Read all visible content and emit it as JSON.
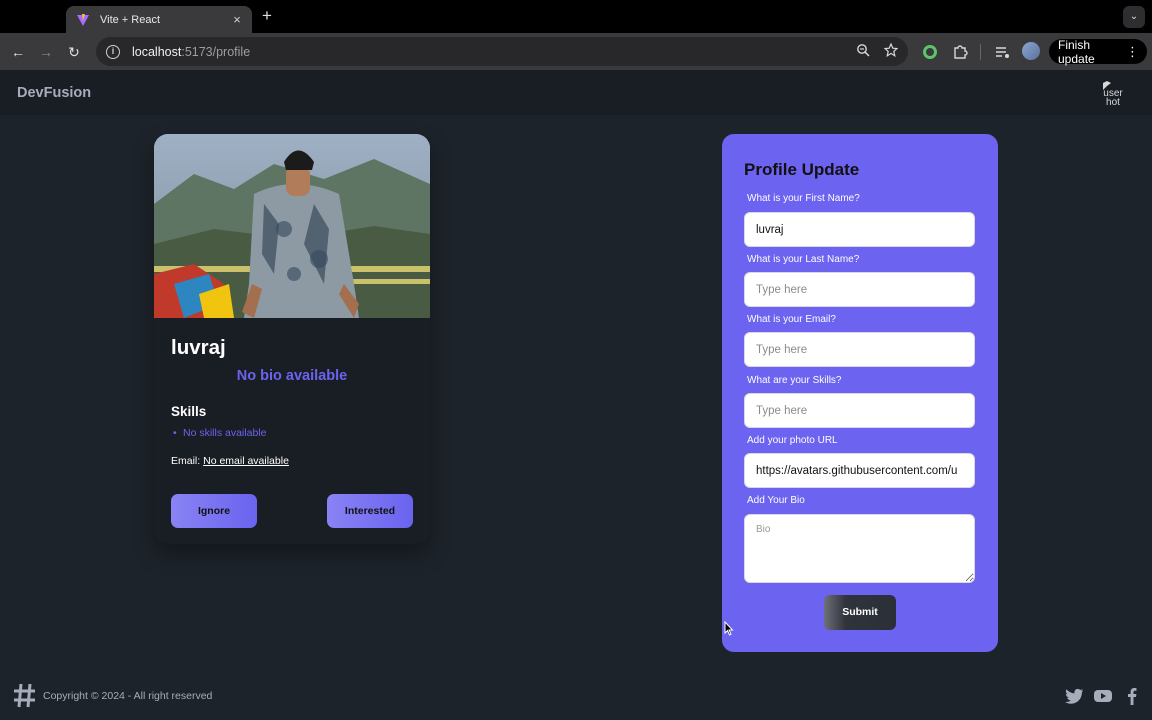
{
  "browser": {
    "tab_title": "Vite + React",
    "tab_close": "×",
    "new_tab": "+",
    "url_host": "localhost",
    "url_rest": ":5173/profile",
    "finish_update_label": "Finish update"
  },
  "navbar": {
    "brand": "DevFusion",
    "avatar_alt": "user hot"
  },
  "profile_card": {
    "name": "luvraj",
    "bio": "No bio available",
    "skills_title": "Skills",
    "skills": [
      "No skills available"
    ],
    "email_label": "Email:",
    "email_value": "No email available",
    "ignore_label": "Ignore",
    "interested_label": "Interested"
  },
  "form": {
    "title": "Profile Update",
    "first_name_label": "What is your First Name?",
    "first_name_value": "luvraj",
    "last_name_label": "What is your Last Name?",
    "last_name_placeholder": "Type here",
    "email_label": "What is your Email?",
    "email_placeholder": "Type here",
    "skills_label": "What are your Skills?",
    "skills_placeholder": "Type here",
    "photo_label": "Add your photo URL",
    "photo_value": "https://avatars.githubusercontent.com/u",
    "bio_label": "Add Your Bio",
    "bio_placeholder": "Bio",
    "submit_label": "Submit"
  },
  "footer": {
    "copyright": "Copyright © 2024 - All right reserved"
  },
  "colors": {
    "accent": "#6c63f0",
    "page_bg": "#1d232a",
    "nav_bg": "#191e24"
  },
  "icons": [
    "back-icon",
    "forward-icon",
    "reload-icon",
    "info-icon",
    "zoom-icon",
    "star-icon",
    "puzzle-icon",
    "queue-icon",
    "kebab-icon",
    "twitter-icon",
    "youtube-icon",
    "facebook-icon",
    "logo-icon"
  ]
}
